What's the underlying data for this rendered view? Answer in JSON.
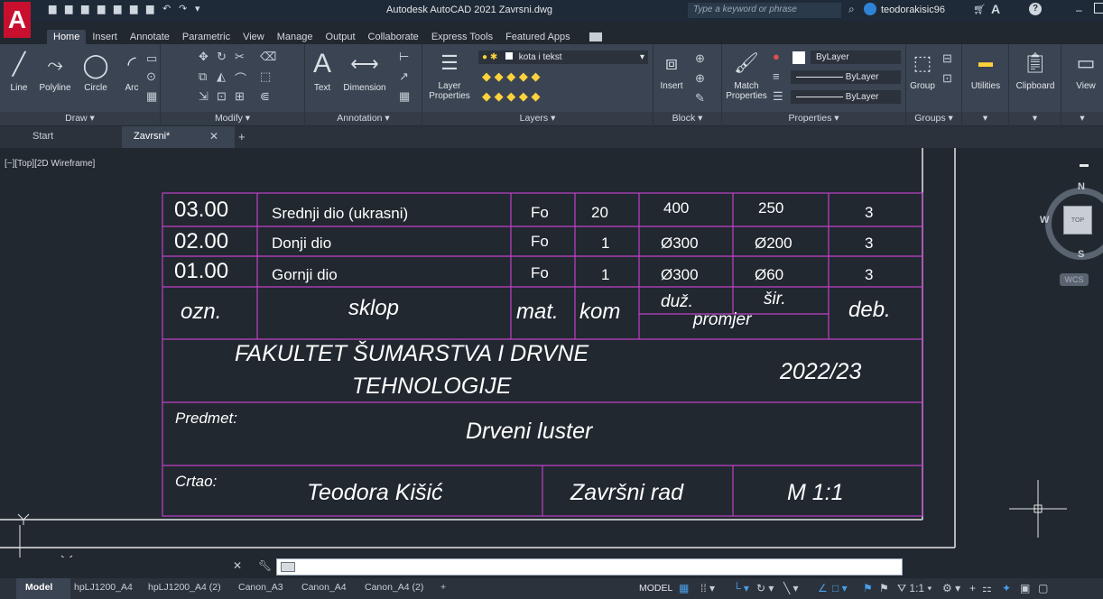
{
  "app": {
    "logo_letter": "A",
    "window_title": "Autodesk AutoCAD 2021   Zavrsni.dwg",
    "search_placeholder": "Type a keyword or phrase",
    "user_name": "teodorakisic96"
  },
  "ribbon": {
    "tabs": [
      "Home",
      "Insert",
      "Annotate",
      "Parametric",
      "View",
      "Manage",
      "Output",
      "Collaborate",
      "Express Tools",
      "Featured Apps"
    ],
    "active_tab": "Home",
    "draw": {
      "label": "Draw ▾",
      "tools": [
        "Line",
        "Polyline",
        "Circle",
        "Arc"
      ]
    },
    "modify": {
      "label": "Modify ▾"
    },
    "annotation": {
      "label": "Annotation ▾",
      "text": "Text",
      "dimension": "Dimension"
    },
    "layers": {
      "label": "Layers ▾",
      "layer_properties": "Layer Properties",
      "current_layer": "kota i tekst"
    },
    "block": {
      "label": "Block ▾",
      "insert": "Insert"
    },
    "properties": {
      "label": "Properties ▾",
      "match": "Match Properties",
      "color": "ByLayer",
      "linetype": "ByLayer",
      "lineweight": "ByLayer"
    },
    "groups": {
      "label": "Groups ▾",
      "group": "Group"
    },
    "utilities": "Utilities",
    "clipboard": "Clipboard",
    "view": "View"
  },
  "file_tabs": {
    "start": "Start",
    "active": "Zavrsni*"
  },
  "viewport": {
    "label": "[−][Top][2D Wireframe]"
  },
  "title_block": {
    "parts": [
      {
        "ozn": "03.00",
        "name": "Srednji dio (ukrasni)",
        "mat": "Fo",
        "kom": "20",
        "duz": "400",
        "sir": "250",
        "deb": "3"
      },
      {
        "ozn": "02.00",
        "name": "Donji dio",
        "mat": "Fo",
        "kom": "1",
        "duz": "Ø300",
        "sir": "Ø200",
        "deb": "3"
      },
      {
        "ozn": "01.00",
        "name": "Gornji dio",
        "mat": "Fo",
        "kom": "1",
        "duz": "Ø300",
        "sir": "Ø60",
        "deb": "3"
      }
    ],
    "headers": {
      "ozn": "ozn.",
      "sklop": "sklop",
      "mat": "mat.",
      "kom": "kom",
      "duz": "duž.",
      "sir": "šir.",
      "promjer": "promjer",
      "deb": "deb."
    },
    "faculty_line1": "FAKULTET ŠUMARSTVA I DRVNE",
    "faculty_line2": "TEHNOLOGIJE",
    "year": "2022/23",
    "predmet_label": "Predmet:",
    "predmet": "Drveni luster",
    "crtao_label": "Crtao:",
    "author": "Teodora Kišić",
    "work_type": "Završni rad",
    "scale": "M 1:1"
  },
  "viewcube": {
    "n": "N",
    "w": "W",
    "s": "S",
    "top": "TOP",
    "wcs": "WCS"
  },
  "statusbar": {
    "layout_tabs": [
      "Model",
      "hpLJ1200_A4",
      "hpLJ1200_A4 (2)",
      "Canon_A3",
      "Canon_A4",
      "Canon_A4 (2)"
    ],
    "mode": "MODEL"
  },
  "colors": {
    "table_lines": "#c040c8",
    "background": "#212830",
    "ribbon": "#3b4453"
  }
}
